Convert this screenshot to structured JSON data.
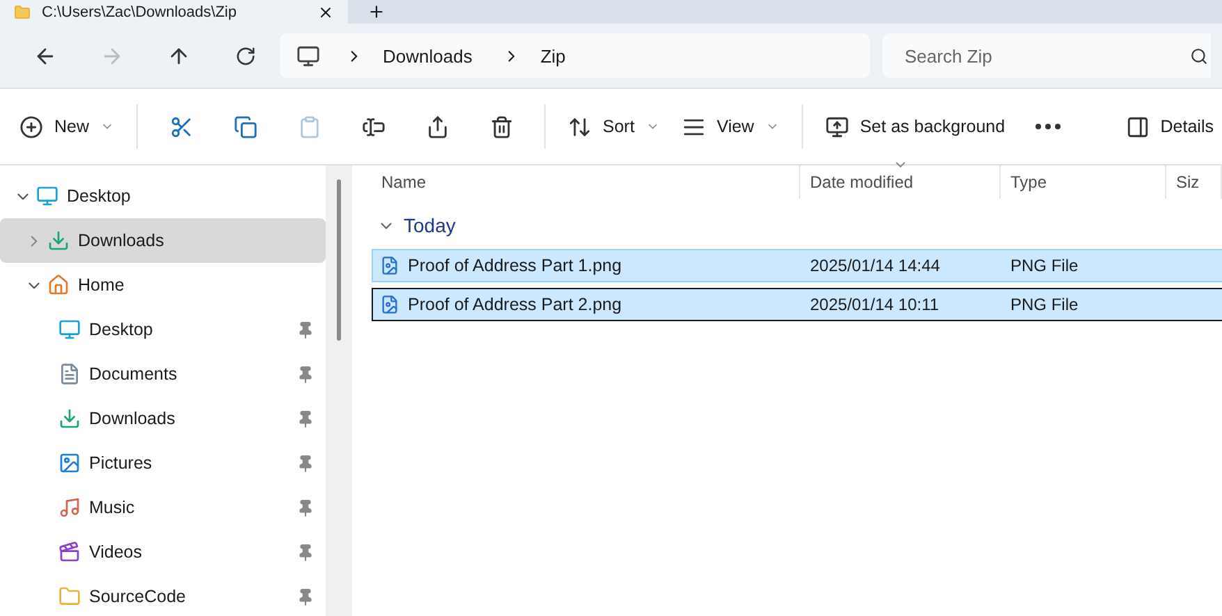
{
  "window": {
    "title": "C:\\Users\\Zac\\Downloads\\Zip"
  },
  "nav": {
    "back_disabled": false,
    "forward_disabled": true
  },
  "breadcrumb": [
    "Downloads",
    "Zip"
  ],
  "search": {
    "placeholder": "Search Zip"
  },
  "toolbar": {
    "groups": [
      {
        "items": [
          {
            "label": "New",
            "dropdown": true,
            "disabled": false
          }
        ]
      },
      {
        "items": [
          {
            "disabled": false
          },
          {
            "disabled": false
          },
          {
            "disabled": true
          },
          {
            "disabled": false
          },
          {
            "disabled": false
          },
          {
            "disabled": false
          }
        ]
      },
      {
        "items": [
          {
            "label": "Sort",
            "dropdown": true,
            "disabled": false
          },
          {
            "label": "View",
            "dropdown": true,
            "disabled": false
          }
        ]
      },
      {
        "items": [
          {
            "label": "Set as background",
            "dropdown": false,
            "disabled": false
          },
          {
            "disabled": false
          }
        ]
      }
    ],
    "details": "Details"
  },
  "sidebar": {
    "items": [
      {
        "label": "Desktop",
        "expanded": true,
        "selected": false,
        "children": [
          {
            "label": "Downloads",
            "expanded": false,
            "selected": true
          },
          {
            "label": "Home",
            "expanded": true,
            "selected": false,
            "children": [
              {
                "label": "Desktop",
                "selected": false,
                "pinned": true
              },
              {
                "label": "Documents",
                "selected": false,
                "pinned": true
              },
              {
                "label": "Downloads",
                "selected": false,
                "pinned": true
              },
              {
                "label": "Pictures",
                "selected": false,
                "pinned": true
              },
              {
                "label": "Music",
                "selected": false,
                "pinned": true
              },
              {
                "label": "Videos",
                "selected": false,
                "pinned": true
              },
              {
                "label": "SourceCode",
                "selected": false,
                "pinned": true
              }
            ]
          }
        ]
      }
    ]
  },
  "table": {
    "columns": [
      {
        "label": "Name",
        "sorted": false
      },
      {
        "label": "Date modified",
        "sorted": true
      },
      {
        "label": "Type",
        "sorted": false
      },
      {
        "label": "Siz",
        "sorted": false
      }
    ],
    "groups": [
      {
        "label": "Today",
        "expanded": true,
        "rows": [
          {
            "name": "Proof of Address Part 1.png",
            "date": "2025/01/14 14:44",
            "type": "PNG File",
            "selected": true,
            "focused": false
          },
          {
            "name": "Proof of Address Part 2.png",
            "date": "2025/01/14 10:11",
            "type": "PNG File",
            "selected": true,
            "focused": true
          }
        ]
      }
    ]
  }
}
